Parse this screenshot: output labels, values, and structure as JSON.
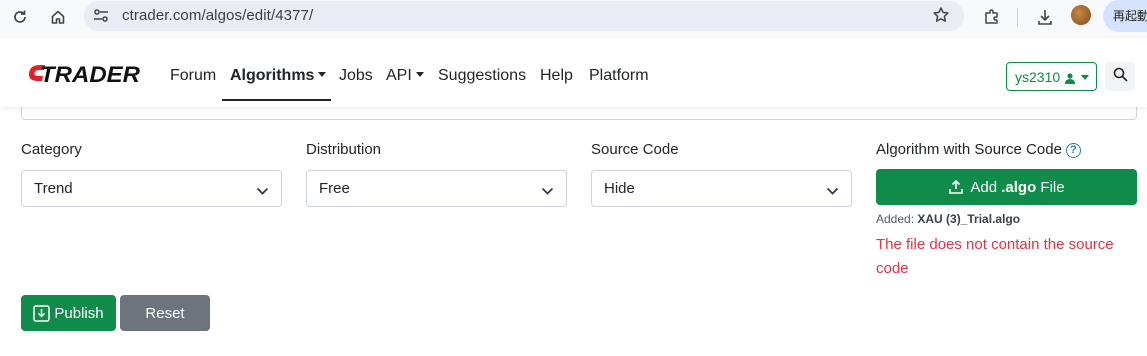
{
  "browser": {
    "url": "ctrader.com/algos/edit/4377/",
    "relaunch_label": "再起動",
    "icons": [
      "reload-icon",
      "home-icon",
      "site-settings-icon",
      "bookmark-star-icon",
      "extensions-icon",
      "download-icon",
      "profile-avatar"
    ]
  },
  "navbar": {
    "logo_text": "cTRADER",
    "items": [
      {
        "label": "Forum"
      },
      {
        "label": "Algorithms",
        "dropdown": true,
        "active": true
      },
      {
        "label": "Jobs"
      },
      {
        "label": "API",
        "dropdown": true
      },
      {
        "label": "Suggestions"
      },
      {
        "label": "Help"
      },
      {
        "label": "Platform"
      }
    ],
    "username": "ys2310",
    "user_icon": "person-icon",
    "search_icon": "search-icon"
  },
  "form": {
    "category": {
      "label": "Category",
      "value": "Trend"
    },
    "distribution": {
      "label": "Distribution",
      "value": "Free"
    },
    "source_code": {
      "label": "Source Code",
      "value": "Hide"
    },
    "algorithm_source": {
      "label": "Algorithm with Source Code",
      "add_button_prefix": "Add ",
      "add_button_ext": ".algo",
      "add_button_suffix": " File",
      "added_prefix": "Added: ",
      "added_file": "XAU (3)_Trial.algo",
      "error": "The file does not contain the source code"
    },
    "publish_label": "Publish",
    "reset_label": "Reset"
  },
  "colors": {
    "primary_green": "#0f8c4a",
    "danger": "#dc3545",
    "secondary": "#6c757d",
    "info_blue": "#2f7dc4"
  }
}
